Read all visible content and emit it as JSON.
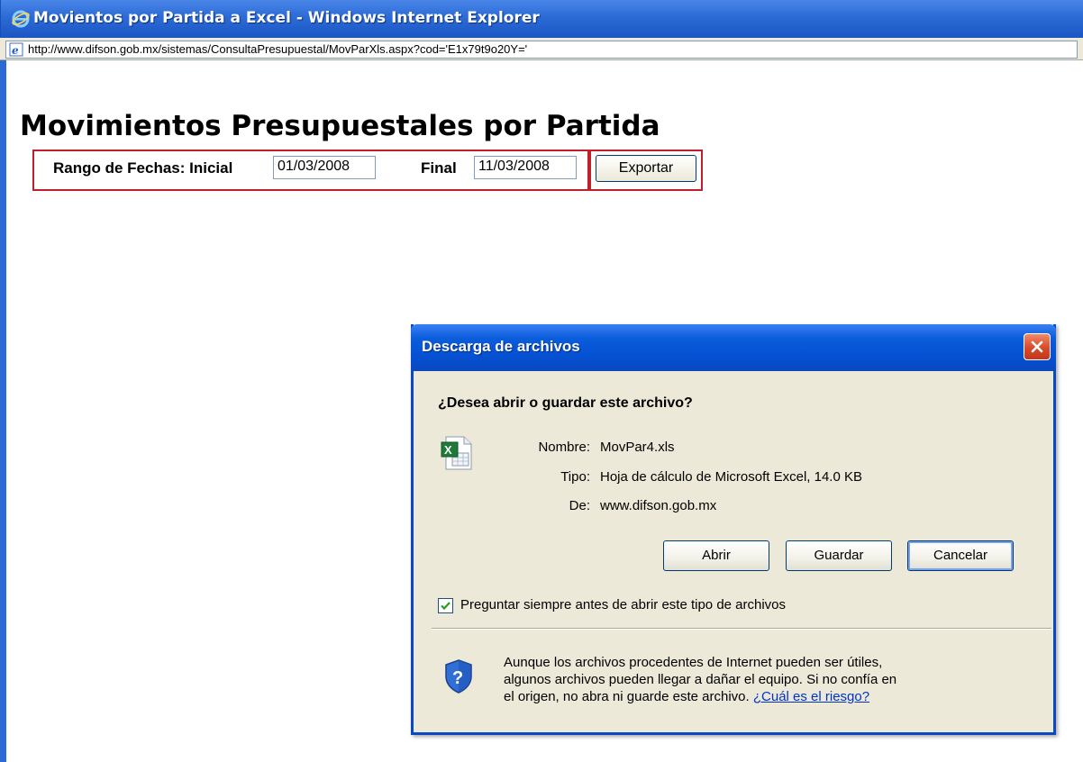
{
  "window": {
    "title": "Movientos por Partida a Excel - Windows Internet Explorer",
    "url": "http://www.difson.gob.mx/sistemas/ConsultaPresupuestal/MovParXls.aspx?cod='E1x79t9o20Y='"
  },
  "page": {
    "title": "Movimientos Presupuestales por Partida",
    "range_label": "Rango de Fechas: Inicial",
    "start_date": "01/03/2008",
    "final_label": "Final",
    "end_date": "11/03/2008",
    "export_button": "Exportar"
  },
  "dialog": {
    "title": "Descarga de archivos",
    "question": "¿Desea abrir o guardar este archivo?",
    "name_label": "Nombre:",
    "name_value": "MovPar4.xls",
    "type_label": "Tipo:",
    "type_value": "Hoja de cálculo de Microsoft Excel, 14.0 KB",
    "from_label": "De:",
    "from_value": "www.difson.gob.mx",
    "open_button": "Abrir",
    "save_button": "Guardar",
    "cancel_button": "Cancelar",
    "always_ask_label": "Preguntar siempre antes de abrir este tipo de archivos",
    "always_ask_checked": true,
    "warning_line1": "Aunque los archivos procedentes de Internet pueden ser útiles,",
    "warning_line2": "algunos archivos pueden llegar a dañar el equipo. Si no confía en",
    "warning_line3": "el origen, no abra ni guarde este archivo.",
    "risk_link": "¿Cuál es el riesgo?"
  },
  "icons": {
    "browser": "internet-explorer-icon",
    "page": "ie-page-icon",
    "close": "close-icon",
    "file": "excel-file-icon",
    "check": "checkmark-icon",
    "warning": "security-shield-icon"
  },
  "colors": {
    "title_bar_blue": "#1b56c4",
    "highlight_red": "#c0202a",
    "dialog_bg": "#ece9d8",
    "close_red": "#d9492a",
    "link_blue": "#0033cc"
  }
}
